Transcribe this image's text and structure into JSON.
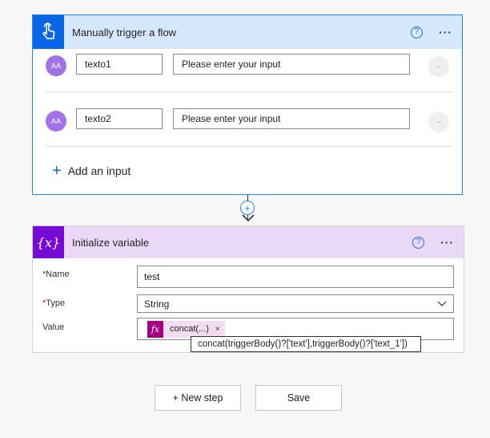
{
  "trigger_card": {
    "title": "Manually trigger a flow",
    "help_label": "?",
    "more_label": "···",
    "inputs": [
      {
        "avatar_text": "AA",
        "name": "texto1",
        "placeholder": "Please enter your input",
        "more": "···"
      },
      {
        "avatar_text": "AA",
        "name": "texto2",
        "placeholder": "Please enter your input",
        "more": "···"
      }
    ],
    "add_input_plus": "+",
    "add_input_label": "Add an input"
  },
  "connector": {
    "plus_label": "+"
  },
  "variable_card": {
    "icon_text": "{x}",
    "title": "Initialize variable",
    "help_label": "?",
    "more_label": "···",
    "name_label": "Name",
    "name_value": "test",
    "type_label": "Type",
    "type_value": "String",
    "required_marker": "*",
    "value_label": "Value",
    "token_icon": "fx",
    "token_text": "concat(...)",
    "token_remove": "×",
    "tooltip": "concat(triggerBody()?['text'],triggerBody()?['text_1'])"
  },
  "buttons": {
    "new_step": "+ New step",
    "save": "Save"
  },
  "colors": {
    "trigger_header": "#d6e8fd",
    "trigger_icon": "#0a66e4",
    "variable_header": "#ead9f6",
    "variable_icon": "#770bd6",
    "token_icon": "#a4007f"
  },
  "icons": {
    "trigger": "hand-touch-icon",
    "variable": "variable-braces-icon",
    "type_dropdown": "chevron-down-icon"
  }
}
